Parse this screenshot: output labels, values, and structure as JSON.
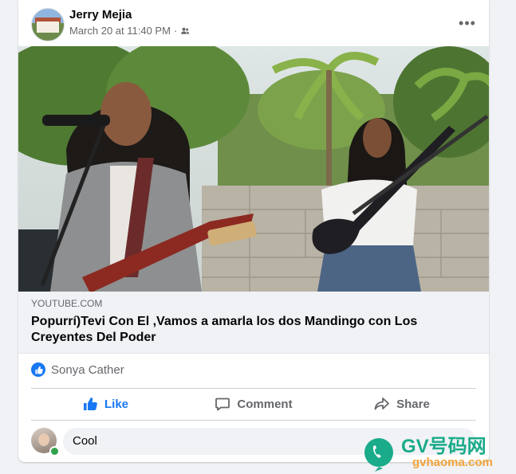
{
  "post": {
    "author": "Jerry Mejia",
    "timestamp": "March 20 at 11:40 PM",
    "separator": "·",
    "audience_icon": "friends-icon",
    "more_icon": "more-options-icon",
    "more_label": "•••"
  },
  "link": {
    "domain": "YOUTUBE.COM",
    "title": "Popurrí)Tevi Con El ,Vamos a amarla los dos Mandingo con Los Creyentes Del Poder"
  },
  "reactions": {
    "icon": "like-reaction-icon",
    "name": "Sonya Cather"
  },
  "actions": [
    {
      "label": "Like",
      "icon": "thumbs-up-icon",
      "active": true
    },
    {
      "label": "Comment",
      "icon": "comment-icon",
      "active": false
    },
    {
      "label": "Share",
      "icon": "share-icon",
      "active": false
    }
  ],
  "comment": {
    "value": "Cool"
  },
  "watermark": {
    "text": "GV号码网",
    "url": "gvhaoma.com"
  },
  "colors": {
    "accent": "#1877f2",
    "secondary_text": "#65676b",
    "online": "#31a24c",
    "watermark_green": "#1aab8a",
    "watermark_orange": "#f2a33a"
  }
}
